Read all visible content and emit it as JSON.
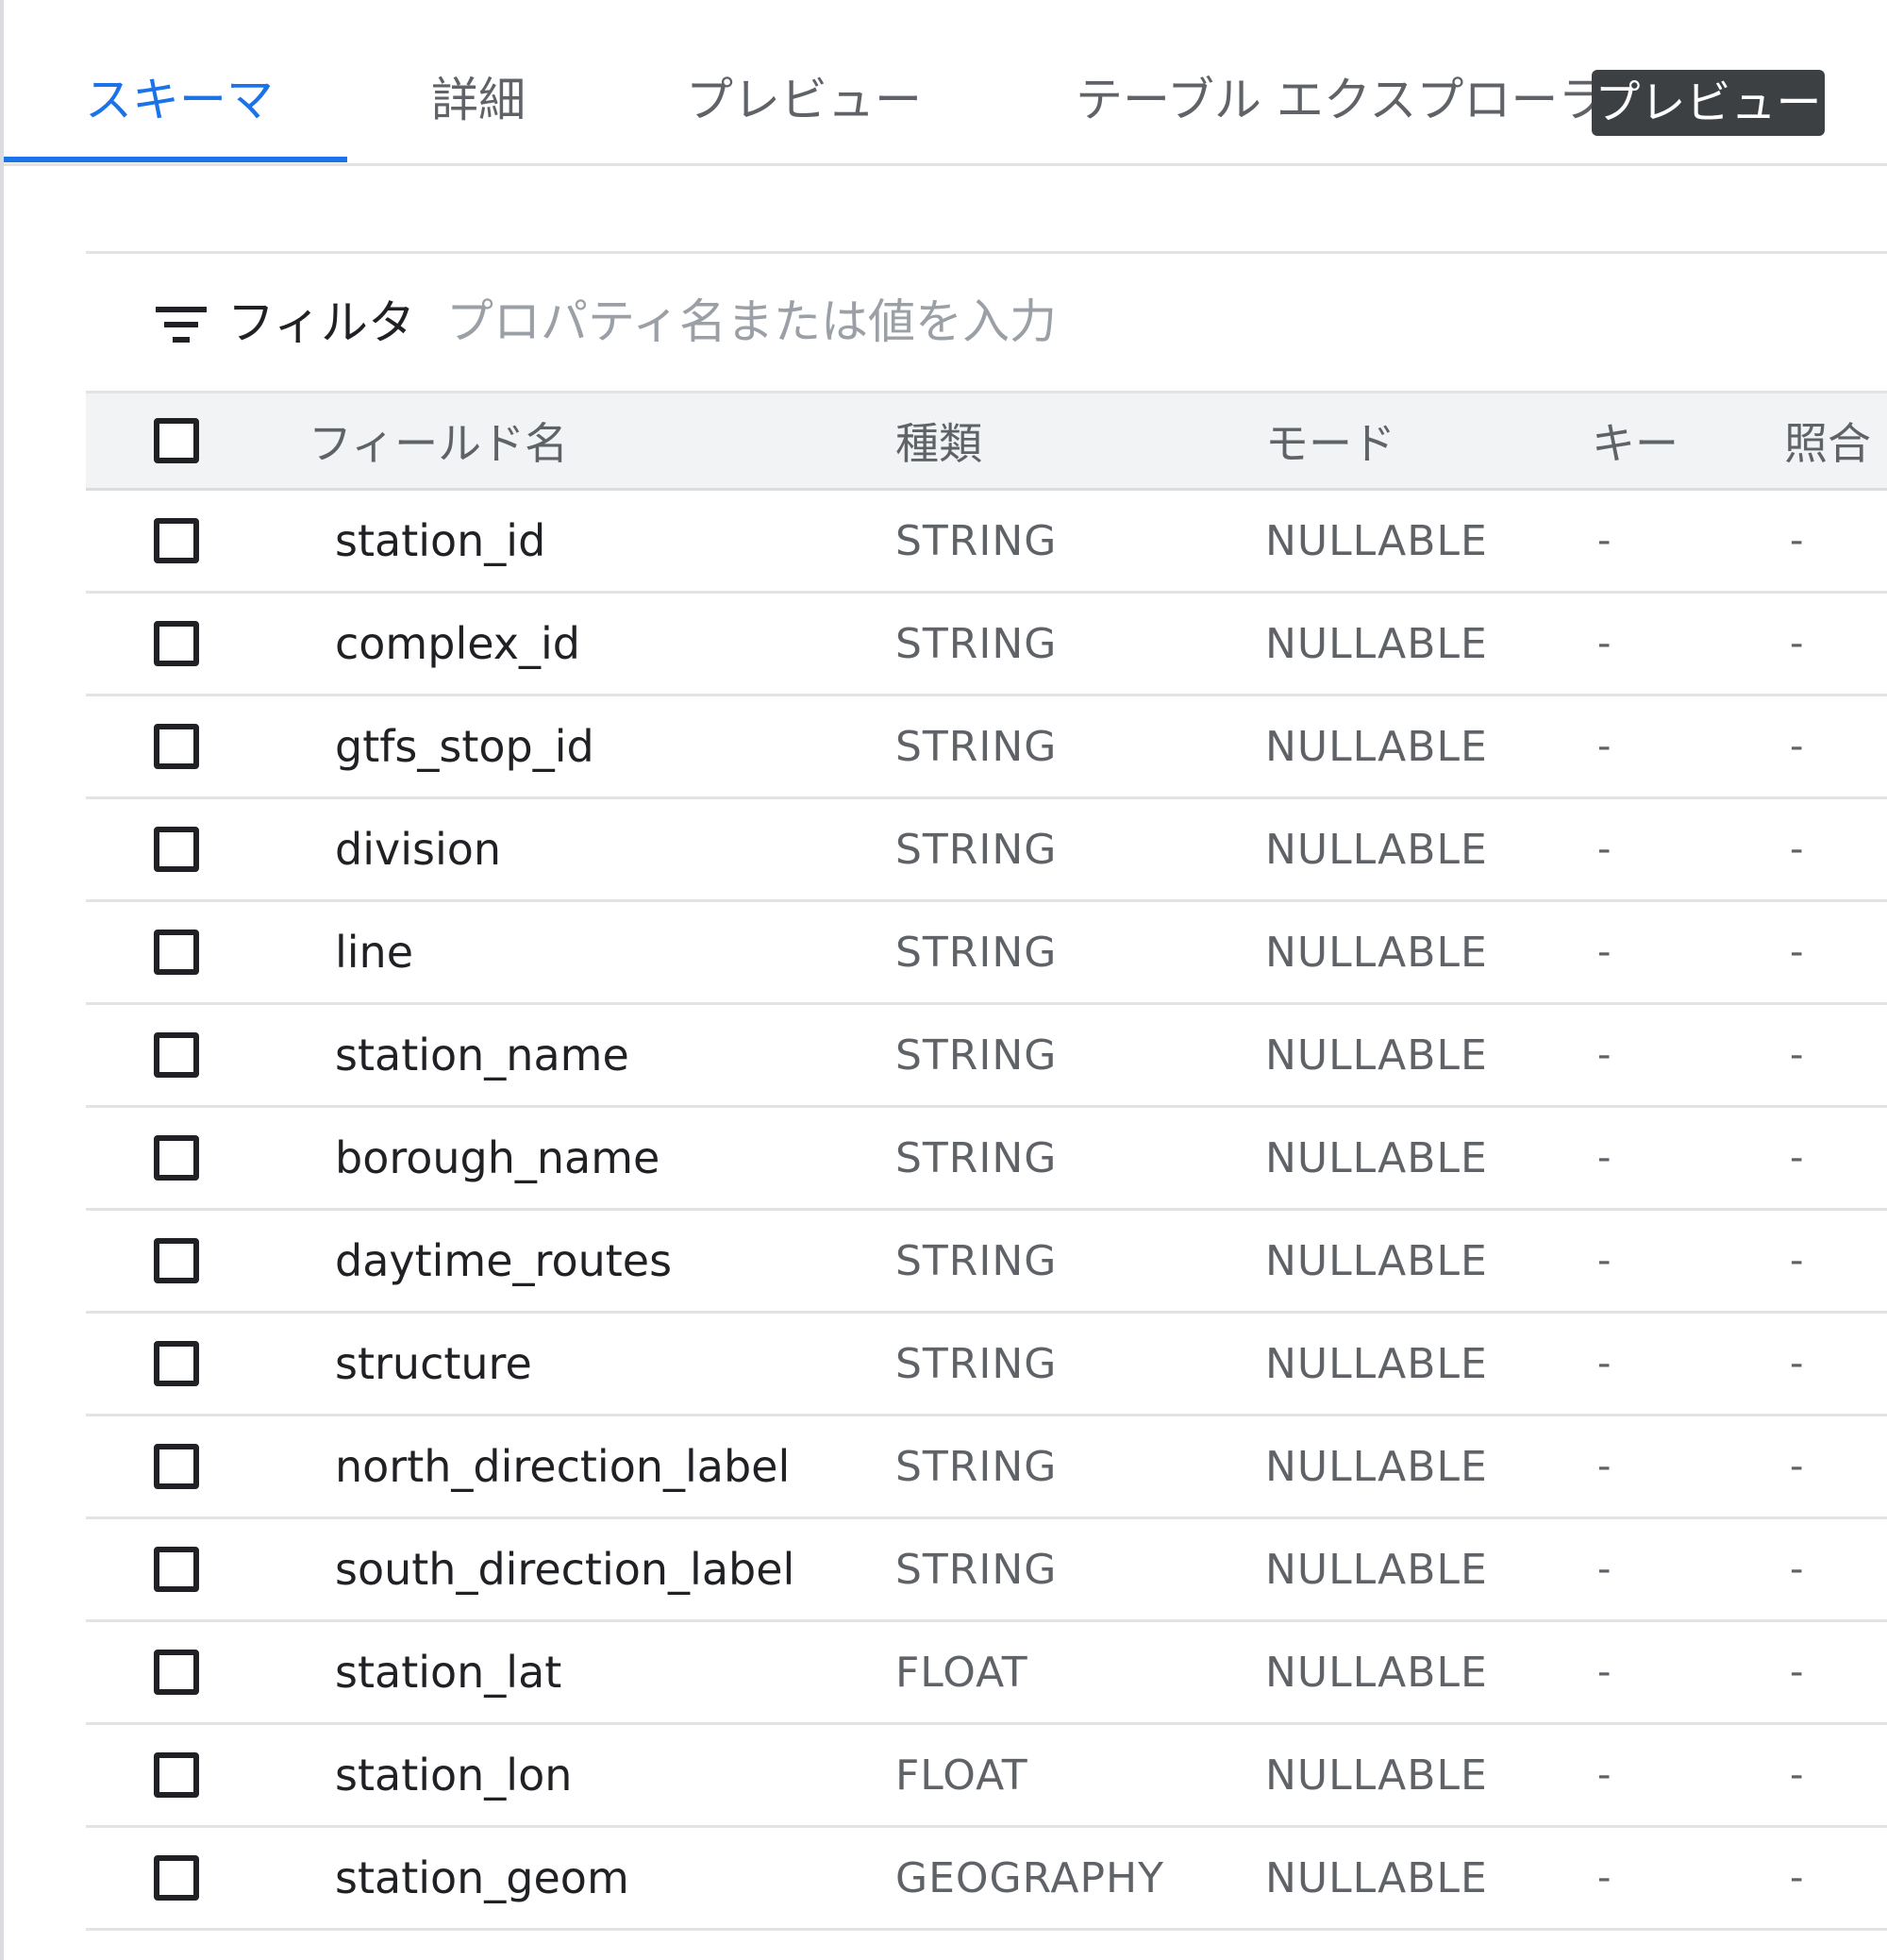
{
  "tabs": [
    {
      "label": "スキーマ",
      "active": true
    },
    {
      "label": "詳細",
      "active": false
    },
    {
      "label": "プレビュー",
      "active": false
    },
    {
      "label": "テーブル エクスプローラ",
      "active": false
    }
  ],
  "preview_badge": "プレビュー",
  "filter": {
    "icon": "filter-list-icon",
    "label": "フィルタ",
    "placeholder": "プロパティ名または値を入力",
    "value": ""
  },
  "table": {
    "columns": {
      "field_name": "フィールド名",
      "type": "種類",
      "mode": "モード",
      "key": "キー",
      "collation": "照合"
    },
    "rows": [
      {
        "name": "station_id",
        "type": "STRING",
        "mode": "NULLABLE",
        "key": "-",
        "collation": "-"
      },
      {
        "name": "complex_id",
        "type": "STRING",
        "mode": "NULLABLE",
        "key": "-",
        "collation": "-"
      },
      {
        "name": "gtfs_stop_id",
        "type": "STRING",
        "mode": "NULLABLE",
        "key": "-",
        "collation": "-"
      },
      {
        "name": "division",
        "type": "STRING",
        "mode": "NULLABLE",
        "key": "-",
        "collation": "-"
      },
      {
        "name": "line",
        "type": "STRING",
        "mode": "NULLABLE",
        "key": "-",
        "collation": "-"
      },
      {
        "name": "station_name",
        "type": "STRING",
        "mode": "NULLABLE",
        "key": "-",
        "collation": "-"
      },
      {
        "name": "borough_name",
        "type": "STRING",
        "mode": "NULLABLE",
        "key": "-",
        "collation": "-"
      },
      {
        "name": "daytime_routes",
        "type": "STRING",
        "mode": "NULLABLE",
        "key": "-",
        "collation": "-"
      },
      {
        "name": "structure",
        "type": "STRING",
        "mode": "NULLABLE",
        "key": "-",
        "collation": "-"
      },
      {
        "name": "north_direction_label",
        "type": "STRING",
        "mode": "NULLABLE",
        "key": "-",
        "collation": "-"
      },
      {
        "name": "south_direction_label",
        "type": "STRING",
        "mode": "NULLABLE",
        "key": "-",
        "collation": "-"
      },
      {
        "name": "station_lat",
        "type": "FLOAT",
        "mode": "NULLABLE",
        "key": "-",
        "collation": "-"
      },
      {
        "name": "station_lon",
        "type": "FLOAT",
        "mode": "NULLABLE",
        "key": "-",
        "collation": "-"
      },
      {
        "name": "station_geom",
        "type": "GEOGRAPHY",
        "mode": "NULLABLE",
        "key": "-",
        "collation": "-"
      }
    ]
  },
  "colors": {
    "accent": "#1a73e8",
    "text_primary": "#202124",
    "text_secondary": "#5f6368",
    "header_bg": "#f1f3f4",
    "badge_bg": "#3c4043",
    "divider": "#e3e3e3"
  }
}
